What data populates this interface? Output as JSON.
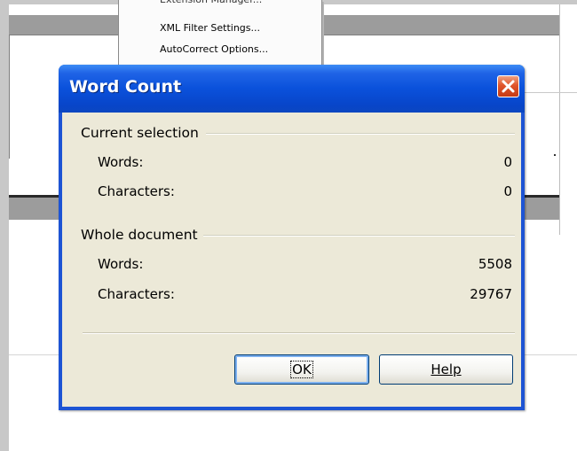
{
  "menu": {
    "items": [
      "Extension Manager...",
      "XML Filter Settings...",
      "AutoCorrect Options..."
    ]
  },
  "dialog": {
    "title": "Word Count",
    "current_selection": {
      "heading": "Current selection",
      "words_label": "Words:",
      "words_value": "0",
      "characters_label": "Characters:",
      "characters_value": "0"
    },
    "whole_document": {
      "heading": "Whole document",
      "words_label": "Words:",
      "words_value": "5508",
      "characters_label": "Characters:",
      "characters_value": "29767"
    },
    "buttons": {
      "ok_label": "OK",
      "help_label": "Help"
    }
  },
  "colors": {
    "titlebar": "#0a51db",
    "dialog_body": "#ece9d8",
    "close_button": "#e0552b"
  },
  "icons": [
    "close-icon"
  ]
}
